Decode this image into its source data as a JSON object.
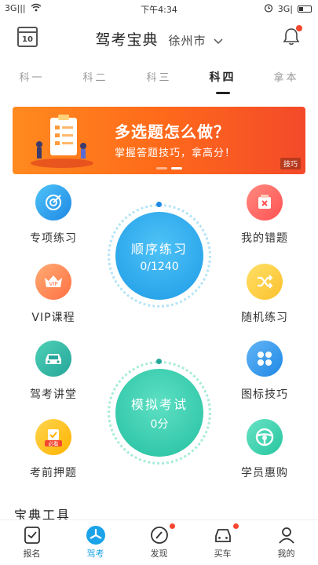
{
  "status_bar": {
    "signal": "3G|||",
    "wifi": "wifi",
    "time": "下午4:34",
    "battery": "3G|"
  },
  "header": {
    "calendar_day": "10",
    "title": "驾考宝典",
    "city": "徐州市",
    "city_chevron": "⌵"
  },
  "tabs": [
    {
      "label": "科一"
    },
    {
      "label": "科二"
    },
    {
      "label": "科三"
    },
    {
      "label": "科四",
      "active": true
    },
    {
      "label": "拿本"
    }
  ],
  "banner": {
    "title": "多选题怎么做？",
    "subtitle": "掌握答题技巧，拿高分！",
    "tag": "技巧"
  },
  "features": {
    "special_practice": "专项练习",
    "my_mistakes": "我的错题",
    "vip_course": "VIP课程",
    "vip_badge": "VIP",
    "random_practice": "随机练习",
    "driving_lecture": "驾考讲堂",
    "icon_tips": "图标技巧",
    "pre_exam": "考前押题",
    "pre_exam_badge": "必看",
    "student_deals": "学员惠购"
  },
  "circles": {
    "sequential": {
      "title": "顺序练习",
      "progress": "0/1240"
    },
    "mock_exam": {
      "title": "模拟考试",
      "score": "0分"
    }
  },
  "section": {
    "title": "宝典工具"
  },
  "bottom_nav": [
    {
      "label": "报名"
    },
    {
      "label": "驾考",
      "active": true
    },
    {
      "label": "发现"
    },
    {
      "label": "买车"
    },
    {
      "label": "我的"
    }
  ],
  "colors": {
    "accent": "#1aa3e8",
    "banner_start": "#ff8a1f",
    "banner_end": "#f34a2a",
    "badge_red": "#f5462e"
  }
}
